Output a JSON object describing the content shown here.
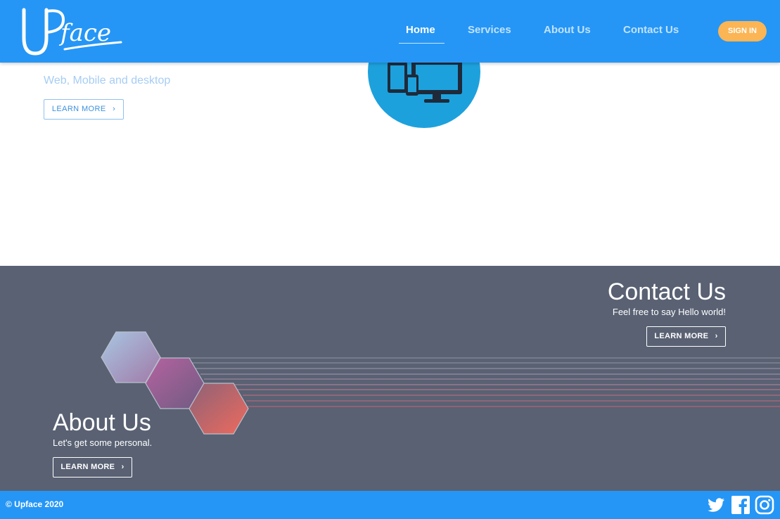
{
  "brand": {
    "logo_text": "UPface"
  },
  "nav": {
    "items": [
      {
        "label": "Home",
        "active": true
      },
      {
        "label": "Services",
        "active": false
      },
      {
        "label": "About Us",
        "active": false
      },
      {
        "label": "Contact Us",
        "active": false
      }
    ],
    "signin_label": "SIGN IN"
  },
  "services": {
    "subtitle": "Web, Mobile and desktop",
    "button_label": "LEARN MORE",
    "icon": "devices-icon"
  },
  "contact": {
    "title": "Contact Us",
    "subtitle": "Feel free to say Hello world!",
    "button_label": "LEARN MORE"
  },
  "about": {
    "title": "About Us",
    "subtitle": "Let's get some personal.",
    "button_label": "LEARN MORE"
  },
  "footer": {
    "copyright": "© Upface 2020",
    "social": [
      "twitter-icon",
      "facebook-icon",
      "instagram-icon"
    ]
  },
  "colors": {
    "primary": "#2596f6",
    "accent": "#fbb554",
    "band": "#596173",
    "circle": "#1da1dd"
  }
}
